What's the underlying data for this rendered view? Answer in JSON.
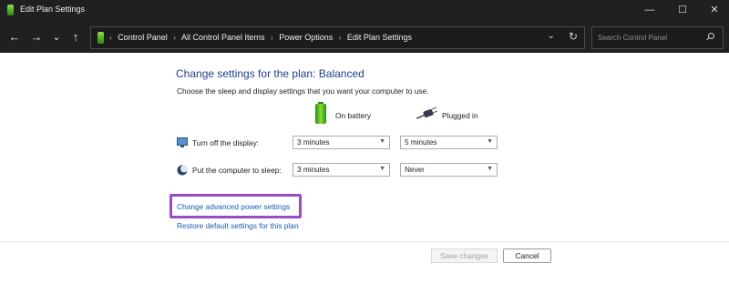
{
  "window": {
    "title": "Edit Plan Settings",
    "controls": {
      "minimize": "—",
      "maximize": "☐",
      "close": "✕"
    }
  },
  "nav": {
    "back": "←",
    "forward": "→",
    "recent": "⌄",
    "up": "↑",
    "breadcrumb": [
      "Control Panel",
      "All Control Panel Items",
      "Power Options",
      "Edit Plan Settings"
    ],
    "separator": "›",
    "dropdown": "⌄",
    "refresh": "↻"
  },
  "search": {
    "placeholder": "Search Control Panel"
  },
  "main": {
    "heading": "Change settings for the plan: Balanced",
    "subtext": "Choose the sleep and display settings that you want your computer to use.",
    "columns": {
      "battery": "On battery",
      "plugged": "Plugged in"
    },
    "rows": [
      {
        "label": "Turn off the display:",
        "battery": "3 minutes",
        "plugged": "5 minutes"
      },
      {
        "label": "Put the computer to sleep:",
        "battery": "3 minutes",
        "plugged": "Never"
      }
    ],
    "links": {
      "advanced": "Change advanced power settings",
      "restore": "Restore default settings for this plan"
    }
  },
  "footer": {
    "save": "Save changes",
    "cancel": "Cancel"
  },
  "colors": {
    "heading": "#1f3f8c",
    "link": "#1a5cb8",
    "highlight": "#9b4bc6",
    "titlebar": "#202020"
  },
  "icons": {
    "app": "battery-icon",
    "battery_column": "battery-icon",
    "plugged_column": "power-plug-icon",
    "display_row": "monitor-icon",
    "sleep_row": "moon-icon"
  }
}
